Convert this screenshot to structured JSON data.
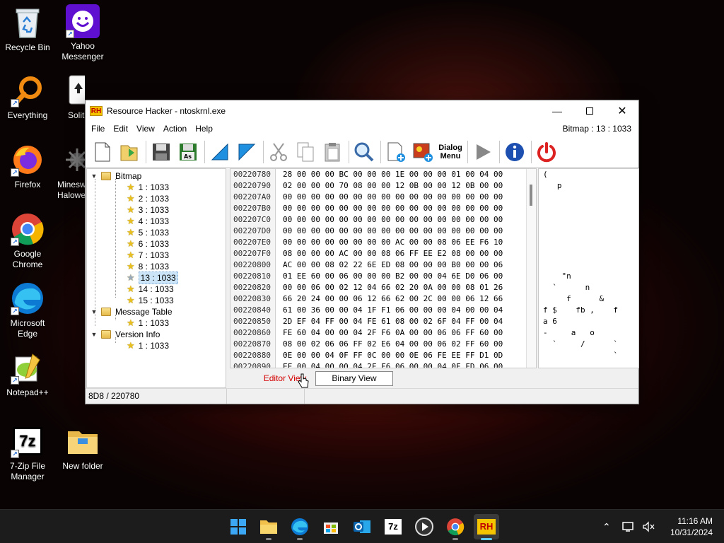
{
  "desktop": {
    "icons": [
      {
        "label": "Recycle Bin"
      },
      {
        "label": "Yahoo Messenger"
      },
      {
        "label": "Everything"
      },
      {
        "label": "Solit"
      },
      {
        "label": "Firefox"
      },
      {
        "label": "Minesw Halowe"
      },
      {
        "label": "Google Chrome"
      },
      {
        "label": "Microsoft Edge"
      },
      {
        "label": "Notepad++"
      },
      {
        "label": "7-Zip File Manager"
      },
      {
        "label": "New folder"
      }
    ]
  },
  "window": {
    "title": "Resource Hacker - ntoskrnl.exe",
    "app_icon_text": "RH",
    "menu": [
      "File",
      "Edit",
      "View",
      "Action",
      "Help"
    ],
    "resource_indicator": "Bitmap : 13 : 1033",
    "toolbar_dialog_label": "Dialog Menu",
    "tree": {
      "groups": [
        {
          "name": "Bitmap",
          "items": [
            "1 : 1033",
            "2 : 1033",
            "3 : 1033",
            "4 : 1033",
            "5 : 1033",
            "6 : 1033",
            "7 : 1033",
            "8 : 1033",
            "13 : 1033",
            "14 : 1033",
            "15 : 1033"
          ]
        },
        {
          "name": "Message Table",
          "items": [
            "1 : 1033"
          ]
        },
        {
          "name": "Version Info",
          "items": [
            "1 : 1033"
          ]
        }
      ],
      "selected": "13 : 1033"
    },
    "hex": {
      "addresses": [
        "00220780",
        "00220790",
        "002207A0",
        "002207B0",
        "002207C0",
        "002207D0",
        "002207E0",
        "002207F0",
        "00220800",
        "00220810",
        "00220820",
        "00220830",
        "00220840",
        "00220850",
        "00220860",
        "00220870",
        "00220880",
        "00220890",
        "002208A0"
      ],
      "rows": [
        "28 00 00 00 BC 00 00 00 1E 00 00 00 01 00 04 00",
        "02 00 00 00 70 08 00 00 12 0B 00 00 12 0B 00 00",
        "00 00 00 00 00 00 00 00 00 00 00 00 00 00 00 00",
        "00 00 00 00 00 00 00 00 00 00 00 00 00 00 00 00",
        "00 00 00 00 00 00 00 00 00 00 00 00 00 00 00 00",
        "00 00 00 00 00 00 00 00 00 00 00 00 00 00 00 00",
        "00 00 00 00 00 00 00 00 AC 00 00 08 06 EE F6 10",
        "08 00 00 00 AC 00 00 08 06 FF EE E2 08 00 00 00",
        "AC 00 00 08 02 22 6E ED 08 00 00 00 B0 00 00 06",
        "01 EE 60 00 06 00 00 00 B2 00 00 04 6E D0 06 00",
        "00 00 06 00 02 12 04 66 02 20 0A 00 00 08 01 26",
        "66 20 24 00 00 06 12 66 62 00 2C 00 00 06 12 66",
        "61 00 36 00 00 04 1F F1 06 00 00 00 04 00 00 04",
        "2D EF 04 FF 00 04 FE 61 08 00 02 6F 04 FF 00 04",
        "FE 60 04 00 00 04 2F F6 0A 00 00 06 06 FF 60 00",
        "08 00 02 06 06 FF 02 E6 04 00 00 06 02 FF 60 00",
        "0E 00 00 04 0F FF 0C 00 00 0E 06 FE EE FF D1 0D",
        "EF 00 04 00 00 04 2F F6 06 00 00 04 0F FD 06 00",
        "00 12 0F FD 00 02 FE 60 00 2F F6 00 06 00 00 04"
      ],
      "ascii": [
        "(",
        "   p",
        "",
        "",
        "",
        "",
        "",
        "",
        "",
        "    \"n",
        "  `      n",
        "     f      &",
        "f $    fb ,    f",
        "a 6",
        "-     a   o",
        "  `     /      `",
        "               `",
        "",
        "      /",
        "       ` /"
      ]
    },
    "tabs": [
      {
        "label": "Editor View",
        "active": true
      },
      {
        "label": "Binary View",
        "active": false
      }
    ],
    "status": "8D8 / 220780"
  },
  "taskbar": {
    "apps": [
      "Start",
      "File Explorer",
      "Microsoft Edge",
      "Microsoft Store",
      "Outlook",
      "7-Zip",
      "Media Player",
      "Google Chrome",
      "Resource Hacker"
    ],
    "rh_text": "RH",
    "sevenzip_text": "7z",
    "clock_time": "11:16 AM",
    "clock_date": "10/31/2024"
  }
}
